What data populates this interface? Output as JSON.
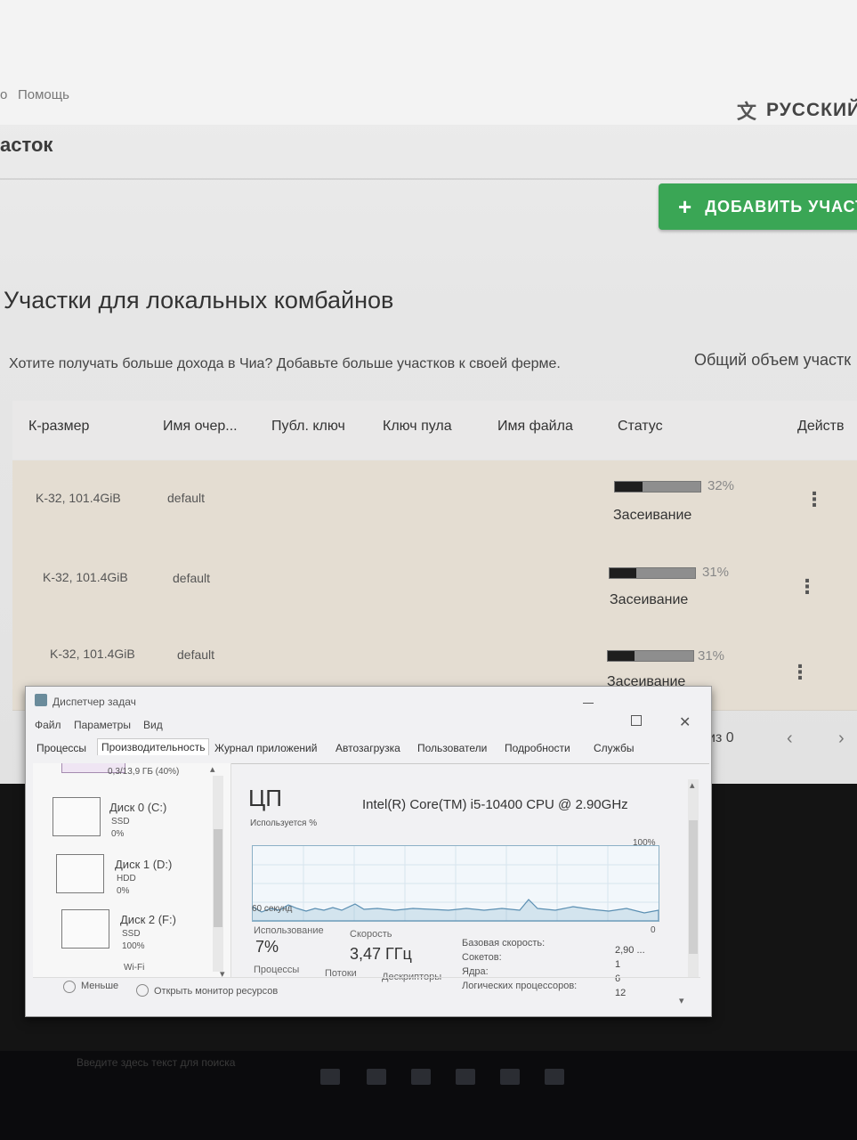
{
  "app": {
    "menu_partial": "о",
    "menu_help": "Помощь",
    "language_label": "РУССКИЙ",
    "section_title": "асток",
    "add_button_label": "ДОБАВИТЬ УЧАСТ",
    "page_title": "Участки для локальных комбайнов",
    "subtitle": "Хотите получать больше дохода в Чиа? Добавьте больше участков к своей ферме.",
    "total_label": "Общий объем участк",
    "table": {
      "headers": [
        "К-размер",
        "Имя очер...",
        "Публ. ключ",
        "Ключ пула",
        "Имя файла",
        "Статус",
        "Действ"
      ],
      "rows": [
        {
          "k_size": "K-32, 101.4GiB",
          "queue": "default",
          "progress": 32,
          "progress_text": "32%",
          "status": "Засеивание"
        },
        {
          "k_size": "K-32, 101.4GiB",
          "queue": "default",
          "progress": 31,
          "progress_text": "31%",
          "status": "Засеивание"
        },
        {
          "k_size": "K-32, 101.4GiB",
          "queue": "default",
          "progress": 31,
          "progress_text": "31%",
          "status": "Засеивание"
        }
      ]
    },
    "pagination_text": "из 0"
  },
  "task_manager": {
    "title": "Диспетчер задач",
    "menu": [
      "Файл",
      "Параметры",
      "Вид"
    ],
    "tabs": [
      "Процессы",
      "Производительность",
      "Журнал приложений",
      "Автозагрузка",
      "Пользователи",
      "Подробности",
      "Службы"
    ],
    "active_tab": "Производительность",
    "left_top_partial": "0,3/13,9 ГБ (40%)",
    "disks": [
      {
        "name": "Диск 0 (C:)",
        "type": "SSD",
        "usage": "0%"
      },
      {
        "name": "Диск 1 (D:)",
        "type": "HDD",
        "usage": "0%"
      },
      {
        "name": "Диск 2 (F:)",
        "type": "SSD",
        "usage": "100%"
      }
    ],
    "left_bottom_partial": "Wi-Fi",
    "cpu": {
      "title": "ЦП",
      "model": "Intel(R) Core(TM) i5-10400 CPU @ 2.90GHz",
      "graph_label": "Используется %",
      "graph_max": "100%",
      "graph_time": "60 секунд",
      "graph_min": "0",
      "utilization_label": "Использование",
      "utilization": "7%",
      "speed_label": "Скорость",
      "speed": "3,47 ГГц",
      "processes_label": "Процессы",
      "threads_label": "Потоки",
      "handles_label": "Дескрипторы",
      "base_speed_label": "Базовая скорость:",
      "base_speed": "2,90 ...",
      "sockets_label": "Сокетов:",
      "sockets": "1",
      "cores_label": "Ядра:",
      "cores": "6",
      "logical_label": "Логических процессоров:",
      "logical": "12"
    },
    "footer_less": "Меньше",
    "footer_monitor": "Открыть монитор ресурсов"
  },
  "taskbar": {
    "search_placeholder": "Введите здесь текст для поиска"
  },
  "colors": {
    "add_button": "#3aa655",
    "progress_fill": "#1e1e1e",
    "row_background": "#e4ddd2"
  },
  "icons": [
    "translate-icon",
    "plus-icon",
    "more-vert-icon",
    "chevron-left-icon",
    "chevron-right-icon",
    "task-manager-icon",
    "minimize-icon",
    "maximize-icon",
    "close-icon"
  ]
}
